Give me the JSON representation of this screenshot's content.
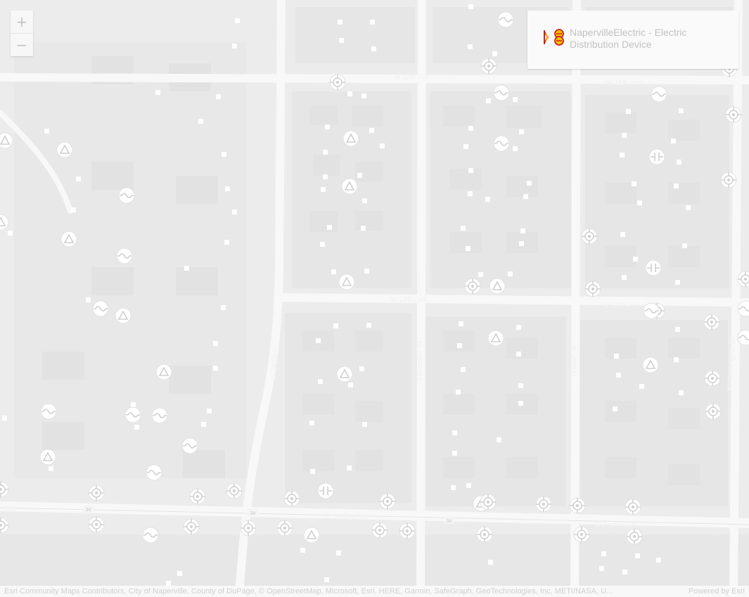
{
  "zoom": {
    "in_label": "+",
    "out_label": "−"
  },
  "legend": {
    "label": "NapervilleElectric - Electric Distribution Device"
  },
  "streets": {
    "w11th_a": "W 11th Ave",
    "w11th_b": "W 11th Ave",
    "w10th_a": "W 10th Ave",
    "w10th_b": "W 10th Ave",
    "ogden_a": "W Ogden Ave",
    "ogden_b": "W Ogden Ave",
    "ogden_c": "Ave",
    "eagle": "N Eagle St",
    "webster": "N Webster St",
    "main": "N Main St",
    "washington": "N Washington St",
    "route": "34"
  },
  "attribution": {
    "text": "Esri Community Maps Contributors, City of Naperville, County of DuPage, © OpenStreetMap, Microsoft, Esri, HERE, Garmin, SafeGraph, GeoTechnologies, Inc, METI/NASA, U...",
    "powered": "Powered by Esri"
  },
  "symbol_types": [
    "triangle-device",
    "switch-device",
    "fuse-device",
    "capacitor-device"
  ],
  "colors": {
    "basemap": "#ececec",
    "road": "#fafafa",
    "marker": "#ffffff",
    "legend_accent": "#f2c100",
    "legend_red": "#d11f1f"
  }
}
